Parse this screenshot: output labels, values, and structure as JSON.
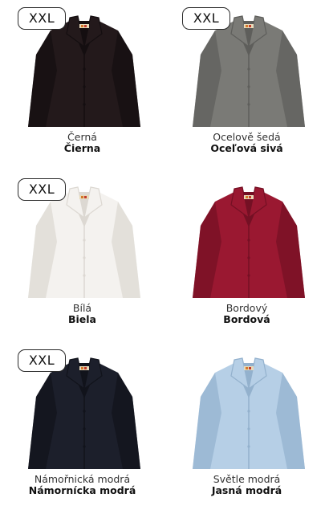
{
  "badge_text": "XXL",
  "products": [
    {
      "name_cz": "Černá",
      "name_sk": "Čierna",
      "color": "#23191b",
      "shade": "#140e10",
      "badge": true
    },
    {
      "name_cz": "Ocelově šedá",
      "name_sk": "Oceľová sivá",
      "color": "#7a7a76",
      "shade": "#5e5e5b",
      "badge": true
    },
    {
      "name_cz": "Bílá",
      "name_sk": "Biela",
      "color": "#f4f2ef",
      "shade": "#dcd8d2",
      "badge": true
    },
    {
      "name_cz": "Bordový",
      "name_sk": "Bordová",
      "color": "#9a1831",
      "shade": "#741024",
      "badge": false
    },
    {
      "name_cz": "Námořnická modrá",
      "name_sk": "Námornícka modrá",
      "color": "#1c1f2b",
      "shade": "#11131b",
      "badge": true
    },
    {
      "name_cz": "Světle modrá",
      "name_sk": "Jasná modrá",
      "color": "#b6cfe6",
      "shade": "#93b1cd",
      "badge": false
    }
  ]
}
